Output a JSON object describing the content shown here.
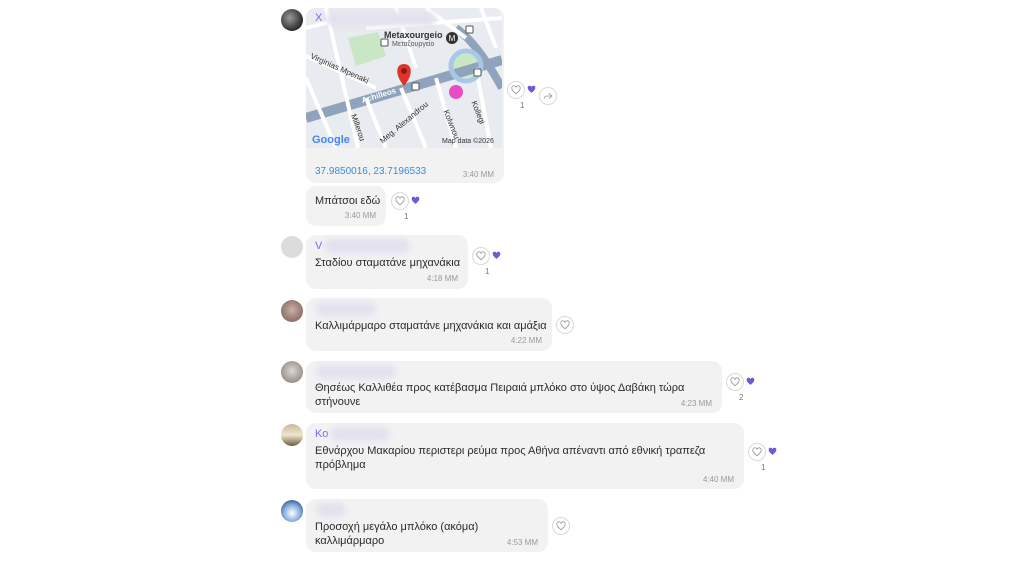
{
  "messages": [
    {
      "sender": "Χ",
      "map": {
        "labels": {
          "metro_en": "Metaxourgeio",
          "metro_el": "Μεταξουργείο",
          "street1": "Virginias Mpenaki",
          "street2": "Achilleos",
          "street3": "Millerou",
          "street4": "Meg. Alexandrou",
          "street5": "Kolwnou",
          "street6": "Kollegi",
          "google": "Google",
          "credit": "Map data ©2026"
        }
      },
      "coords": "37.9850016, 23.7196533",
      "time": "3:40 MM",
      "reaction_count": "1"
    },
    {
      "text": "Μπάτσοι εδώ",
      "time": "3:40 MM",
      "reaction_count": "1"
    },
    {
      "sender": "V",
      "text": "Σταδίου σταματάνε μηχανάκια",
      "time": "4:18 MM",
      "reaction_count": "1"
    },
    {
      "sender": "",
      "text": "Καλλιμάρμαρο σταματάνε μηχανάκια και αμάξια",
      "time": "4:22 MM",
      "reaction_count": ""
    },
    {
      "sender": "",
      "text": "Θησέως Καλλιθέα προς κατέβασμα Πειραιά μπλόκο στο ύψος Δαβάκη τώρα στήνουνε",
      "time": "4:23 MM",
      "reaction_count": "2"
    },
    {
      "sender": "Κο",
      "text_line1": "Εθνάρχου Μακαρίου περιστερι ρεύμα προς Αθήνα απέναντι από εθνική τραπεζα",
      "text_line2": "πρόβλημα",
      "time": "4:40 MM",
      "reaction_count": "1"
    },
    {
      "sender": "",
      "text": "Προσοχή μεγάλο μπλόκο (ακόμα) καλλιμάρμαρο",
      "time": "4:53 MM",
      "reaction_count": ""
    }
  ],
  "colors": {
    "accent": "#7b68ee",
    "bubble": "#f2f2f3",
    "link": "#3a8dd8",
    "map_pin": "#e0322b"
  }
}
